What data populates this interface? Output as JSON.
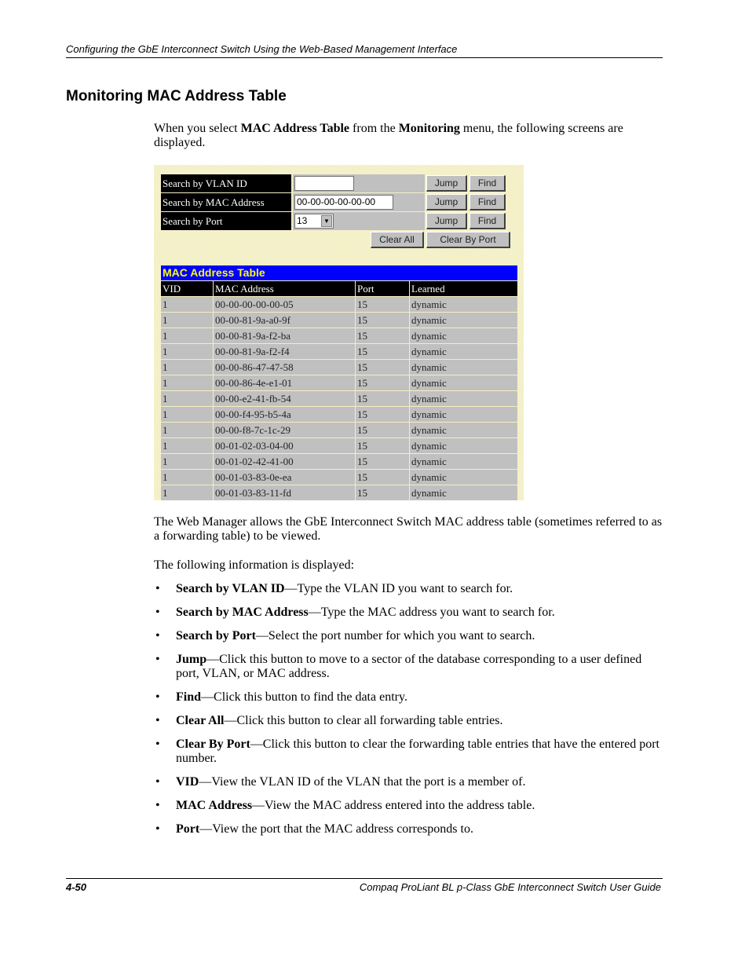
{
  "header": {
    "running_title": "Configuring the GbE Interconnect Switch Using the Web-Based Management Interface"
  },
  "section": {
    "title": "Monitoring MAC Address Table"
  },
  "intro": {
    "t1": "When you select ",
    "b1": "MAC Address Table",
    "t2": " from the ",
    "b2": "Monitoring",
    "t3": " menu, the following screens are displayed."
  },
  "screenshot": {
    "search": [
      {
        "label": "Search by VLAN ID",
        "value": "",
        "jump": "Jump",
        "find": "Find"
      },
      {
        "label": "Search by MAC Address",
        "value": "00-00-00-00-00-00",
        "jump": "Jump",
        "find": "Find"
      },
      {
        "label": "Search by Port",
        "value": "13",
        "jump": "Jump",
        "find": "Find"
      }
    ],
    "clear_all": "Clear All",
    "clear_by_port": "Clear By Port",
    "table_title": "MAC Address Table",
    "columns": [
      "VID",
      "MAC Address",
      "Port",
      "Learned"
    ],
    "rows": [
      [
        "1",
        "00-00-00-00-00-05",
        "15",
        "dynamic"
      ],
      [
        "1",
        "00-00-81-9a-a0-9f",
        "15",
        "dynamic"
      ],
      [
        "1",
        "00-00-81-9a-f2-ba",
        "15",
        "dynamic"
      ],
      [
        "1",
        "00-00-81-9a-f2-f4",
        "15",
        "dynamic"
      ],
      [
        "1",
        "00-00-86-47-47-58",
        "15",
        "dynamic"
      ],
      [
        "1",
        "00-00-86-4e-e1-01",
        "15",
        "dynamic"
      ],
      [
        "1",
        "00-00-e2-41-fb-54",
        "15",
        "dynamic"
      ],
      [
        "1",
        "00-00-f4-95-b5-4a",
        "15",
        "dynamic"
      ],
      [
        "1",
        "00-00-f8-7c-1c-29",
        "15",
        "dynamic"
      ],
      [
        "1",
        "00-01-02-03-04-00",
        "15",
        "dynamic"
      ],
      [
        "1",
        "00-01-02-42-41-00",
        "15",
        "dynamic"
      ],
      [
        "1",
        "00-01-03-83-0e-ea",
        "15",
        "dynamic"
      ],
      [
        "1",
        "00-01-03-83-11-fd",
        "15",
        "dynamic"
      ]
    ]
  },
  "para1": "The Web Manager allows the GbE Interconnect Switch MAC address table (sometimes referred to as a forwarding table) to be viewed.",
  "para2": "The following information is displayed:",
  "bullets": [
    {
      "term": "Search by VLAN ID",
      "desc": "—Type the VLAN ID you want to search for."
    },
    {
      "term": "Search by MAC Address",
      "desc": "—Type the MAC address you want to search for."
    },
    {
      "term": "Search by Port",
      "desc": "—Select the port number for which you want to search."
    },
    {
      "term": "Jump",
      "desc": "—Click this button to move to a sector of the database corresponding to a user defined port, VLAN, or MAC address."
    },
    {
      "term": "Find",
      "desc": "—Click this button to find the data entry."
    },
    {
      "term": "Clear All",
      "desc": "—Click this button to clear all forwarding table entries."
    },
    {
      "term": "Clear By Port",
      "desc": "—Click this button to clear the forwarding table entries that have the entered port number."
    },
    {
      "term": "VID",
      "desc": "—View the VLAN ID of the VLAN that the port is a member of."
    },
    {
      "term": "MAC Address",
      "desc": "—View the MAC address entered into the address table."
    },
    {
      "term": "Port",
      "desc": "—View the port that the MAC address corresponds to."
    }
  ],
  "footer": {
    "page": "4-50",
    "guide": "Compaq ProLiant BL p-Class GbE Interconnect Switch User Guide"
  }
}
